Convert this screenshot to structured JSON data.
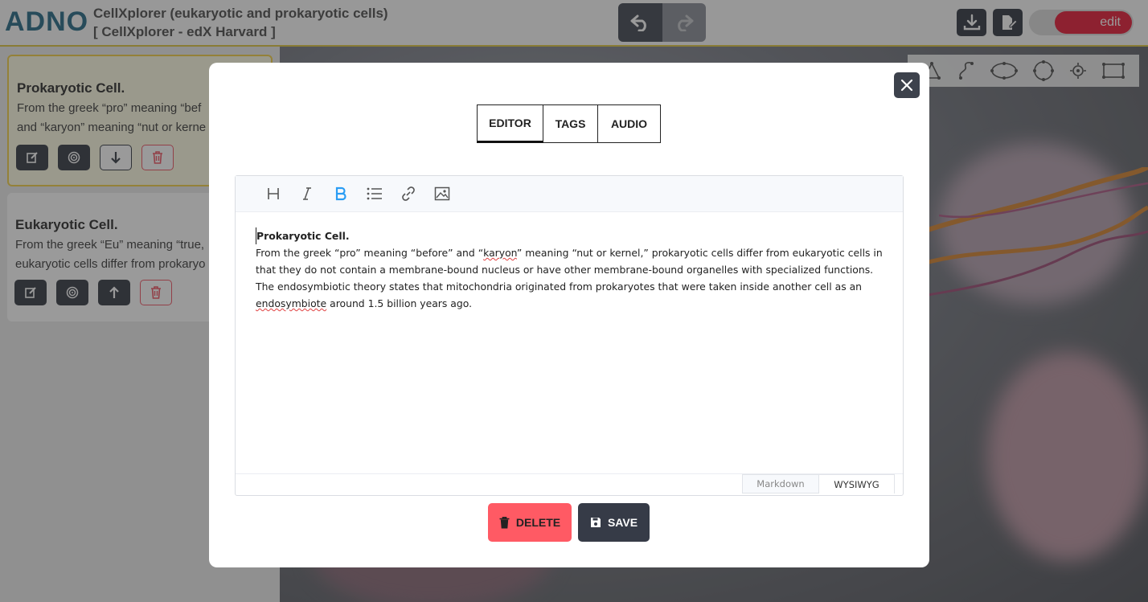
{
  "app": {
    "logo": "ADNO",
    "project_title_line1": "CellXplorer (eukaryotic and prokaryotic cells)",
    "project_title_line2": "[ CellXplorer - edX Harvard ]",
    "toggle_label": "edit",
    "accent_color": "#e8233e"
  },
  "header": {
    "undo_icon": "undo-icon",
    "redo_icon": "redo-icon",
    "download_icon": "download-icon",
    "edit_doc_icon": "edit-document-icon"
  },
  "sidebar": {
    "cards": [
      {
        "title": "Prokaryotic Cell.",
        "line1": "From the greek “pro” meaning “bef",
        "line2": "and “karyon” meaning “nut or kerne",
        "move_icon": "arrow-down-icon"
      },
      {
        "title": "Eukaryotic Cell.",
        "line1": "From the greek “Eu” meaning “true,",
        "line2": "eukaryotic cells differ from prokaryo",
        "move_icon": "arrow-up-icon"
      }
    ]
  },
  "modal": {
    "tabs": [
      "EDITOR",
      "TAGS",
      "AUDIO"
    ],
    "active_tab": "EDITOR",
    "toolbar_icons": [
      "heading-icon",
      "italic-icon",
      "bold-icon",
      "bullet-list-icon",
      "link-icon",
      "image-icon"
    ],
    "content_title": "Prokaryotic Cell.",
    "content_part1": "From the greek “pro” meaning “before” and “",
    "content_karyon": "karyon",
    "content_part2": "” meaning “nut or kernel,” prokaryotic cells differ from eukaryotic cells in that they do not contain a membrane-bound nucleus or have other membrane-bound organelles with specialized functions. The endosymbiotic theory states that mitochondria originated from prokaryotes that were taken inside another cell as an ",
    "content_endo": "endosymbiote",
    "content_part3": " around 1.5 billion years ago.",
    "mode_markdown": "Markdown",
    "mode_wysiwyg": "WYSIWYG",
    "delete_label": "DELETE",
    "save_label": "SAVE"
  }
}
